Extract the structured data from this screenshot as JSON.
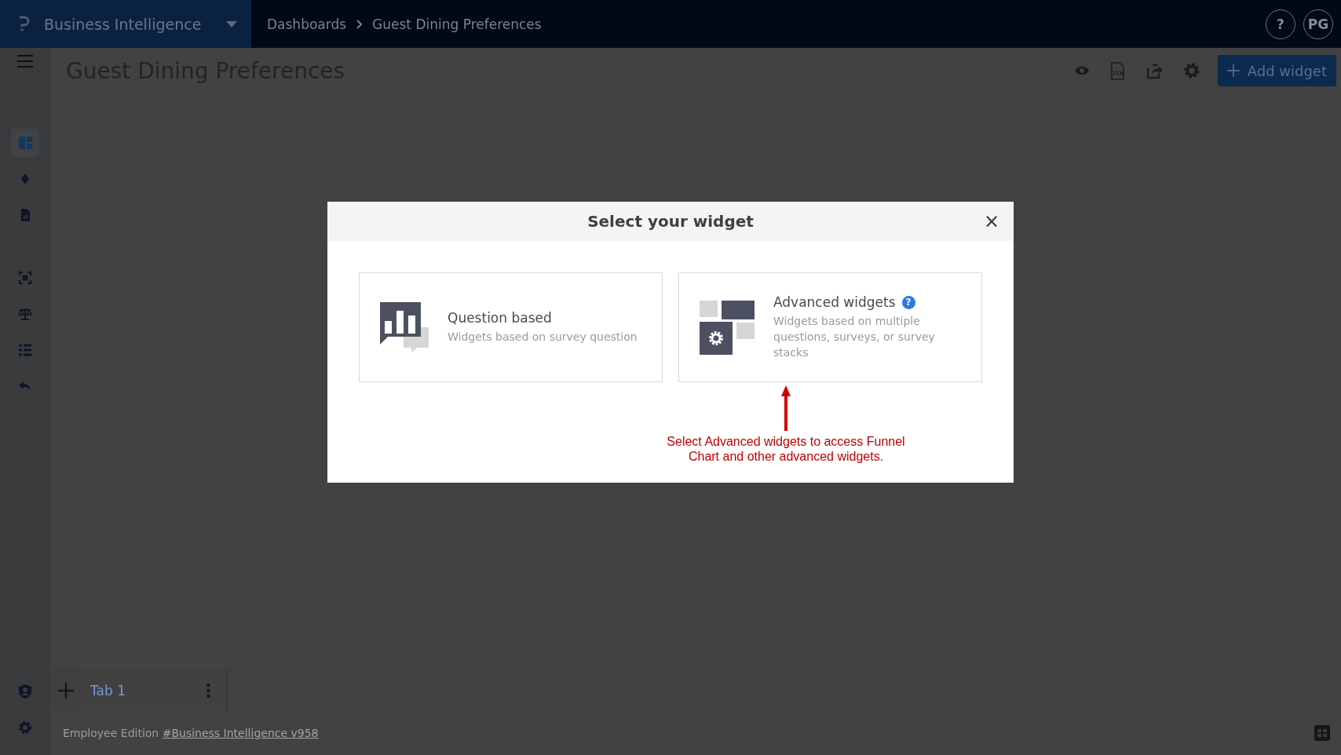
{
  "app_bar": {
    "app_name": "Business Intelligence",
    "breadcrumbs": [
      "Dashboards",
      "Guest Dining Preferences"
    ],
    "help": "?",
    "avatar": "PG"
  },
  "sidebar": {
    "items": [
      {
        "selected": true
      },
      {
        "selected": false
      },
      {
        "selected": false
      },
      {
        "selected": false
      },
      {
        "selected": false
      },
      {
        "selected": false
      },
      {
        "selected": false
      }
    ]
  },
  "page": {
    "title": "Guest Dining Preferences",
    "add_button": "Add widget"
  },
  "dialog": {
    "title": "Select your widget",
    "close": "×",
    "options": [
      {
        "kind": "question",
        "title": "Question based",
        "description": "Widgets based on survey question"
      },
      {
        "kind": "advanced",
        "title": "Advanced widgets",
        "description": "Widgets based on multiple questions, surveys, or survey stacks",
        "help": "?"
      }
    ],
    "annotation": "Select Advanced widgets to access Funnel Chart and other advanced widgets."
  },
  "tabs": [
    {
      "label": "Tab 1",
      "selected": true
    }
  ],
  "footer": {
    "edition": "Employee Edition",
    "link": "#Business Intelligence v958"
  }
}
